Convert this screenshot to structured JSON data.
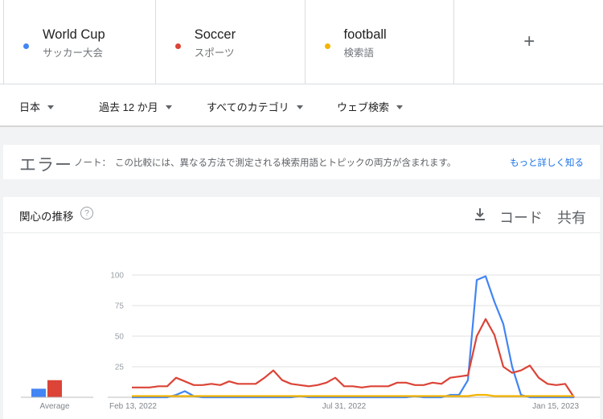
{
  "terms": [
    {
      "name": "World Cup",
      "sub": "サッカー大会",
      "color": "#4285f4"
    },
    {
      "name": "Soccer",
      "sub": "スポーツ",
      "color": "#db4437"
    },
    {
      "name": "football",
      "sub": "検索語",
      "color": "#f4b400"
    }
  ],
  "add_label": "+",
  "filters": {
    "region": "日本",
    "period": "過去 12 か月",
    "category": "すべてのカテゴリ",
    "search_type": "ウェブ検索"
  },
  "error": {
    "title": "エラー",
    "note_label": "ノート：",
    "note_text": "この比較には、異なる方法で測定される検索用語とトピックの両方が含まれます。",
    "link": "もっと詳しく知る"
  },
  "panel": {
    "title": "関心の推移",
    "help": "?",
    "code_label": "コード",
    "share_label": "共有"
  },
  "colors": {
    "world_cup": "#4285f4",
    "soccer": "#db4437",
    "football": "#f4b400",
    "grid": "#e0e0e0"
  },
  "chart_data": {
    "type": "line",
    "title": "",
    "xlabel": "",
    "ylabel": "",
    "ylim": [
      0,
      100
    ],
    "yticks": [
      25,
      50,
      75,
      100
    ],
    "x_tick_labels": [
      {
        "index": 0,
        "label": "Feb 13, 2022"
      },
      {
        "index": 24,
        "label": "Jul 31, 2022"
      },
      {
        "index": 48,
        "label": "Jan 15, 2023"
      }
    ],
    "average_label": "Average",
    "averages": [
      {
        "series": "World Cup",
        "value": 7
      },
      {
        "series": "Soccer",
        "value": 14
      }
    ],
    "grid": true,
    "series": [
      {
        "name": "World Cup",
        "values": [
          0,
          0,
          0,
          0,
          0,
          2,
          5,
          1,
          0,
          0,
          0,
          0,
          0,
          0,
          0,
          0,
          0,
          0,
          0,
          1,
          0,
          0,
          0,
          0,
          0,
          0,
          0,
          0,
          0,
          0,
          0,
          0,
          1,
          0,
          0,
          0,
          2,
          2,
          14,
          96,
          99,
          78,
          60,
          25,
          2,
          0,
          0,
          0,
          0,
          0,
          0
        ]
      },
      {
        "name": "Soccer",
        "values": [
          8,
          8,
          8,
          9,
          9,
          16,
          13,
          10,
          10,
          11,
          10,
          13,
          11,
          11,
          11,
          16,
          22,
          14,
          11,
          10,
          9,
          10,
          12,
          16,
          9,
          9,
          8,
          9,
          9,
          9,
          12,
          12,
          10,
          10,
          12,
          11,
          16,
          17,
          18,
          50,
          64,
          51,
          25,
          20,
          22,
          26,
          16,
          11,
          10,
          11,
          0
        ]
      },
      {
        "name": "football",
        "values": [
          1,
          1,
          1,
          1,
          1,
          1,
          1,
          1,
          1,
          1,
          1,
          1,
          1,
          1,
          1,
          1,
          1,
          1,
          1,
          1,
          1,
          1,
          1,
          1,
          1,
          1,
          1,
          1,
          1,
          1,
          1,
          1,
          1,
          1,
          1,
          1,
          1,
          1,
          1,
          2,
          2,
          1,
          1,
          1,
          1,
          1,
          1,
          1,
          1,
          1,
          1
        ]
      }
    ]
  }
}
